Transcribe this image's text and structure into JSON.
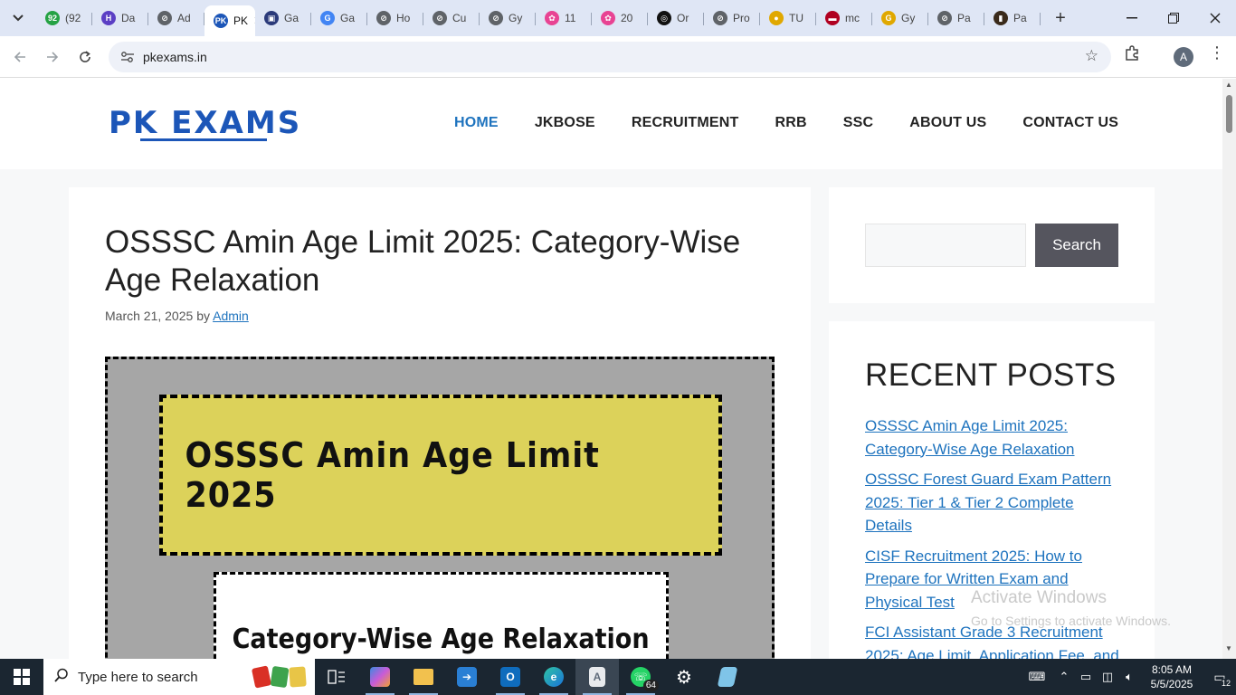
{
  "browser": {
    "tabs": [
      {
        "label": "(92",
        "color": "#25a244",
        "glyph": "92"
      },
      {
        "label": "Da",
        "color": "#5b3fc4",
        "glyph": "H"
      },
      {
        "label": "Ad",
        "color": "#5f6368",
        "glyph": "⊘"
      },
      {
        "label": "PK",
        "color": "#1c56b8",
        "glyph": "PK",
        "active": true
      },
      {
        "label": "Ga",
        "color": "#2b3a7a",
        "glyph": "▣"
      },
      {
        "label": "Ga",
        "color": "#4285f4",
        "glyph": "G"
      },
      {
        "label": "Ho",
        "color": "#5f6368",
        "glyph": "⊘"
      },
      {
        "label": "Cu",
        "color": "#5f6368",
        "glyph": "⊘"
      },
      {
        "label": "Gy",
        "color": "#5f6368",
        "glyph": "⊘"
      },
      {
        "label": "11",
        "color": "#e84393",
        "glyph": "✿"
      },
      {
        "label": "20",
        "color": "#e84393",
        "glyph": "✿"
      },
      {
        "label": "Or",
        "color": "#111111",
        "glyph": "◎"
      },
      {
        "label": "Pro",
        "color": "#5f6368",
        "glyph": "⊘"
      },
      {
        "label": "TU",
        "color": "#e0a800",
        "glyph": "●"
      },
      {
        "label": "mc",
        "color": "#b00020",
        "glyph": "▬"
      },
      {
        "label": "Gy",
        "color": "#e0a800",
        "glyph": "G"
      },
      {
        "label": "Pa",
        "color": "#5f6368",
        "glyph": "⊘"
      },
      {
        "label": "Pa",
        "color": "#3a2a1a",
        "glyph": "▮"
      }
    ],
    "active_tab_close": "✕",
    "new_tab": "+",
    "url": "pkexams.in",
    "avatar_letter": "A",
    "icons": {
      "tab_search": "chevron-down-icon",
      "back": "arrow-left-icon",
      "forward": "arrow-right-icon",
      "reload": "reload-icon",
      "site_info": "tune-icon",
      "bookmark": "star-icon",
      "extensions": "puzzle-icon",
      "menu": "kebab-icon"
    }
  },
  "site": {
    "logo": "PK EXAMS",
    "nav": [
      {
        "label": "HOME",
        "current": true
      },
      {
        "label": "JKBOSE"
      },
      {
        "label": "RECRUITMENT"
      },
      {
        "label": "RRB"
      },
      {
        "label": "SSC"
      },
      {
        "label": "ABOUT US"
      },
      {
        "label": "CONTACT US"
      }
    ],
    "accent": "#1e73be",
    "logo_color": "#1c56b8"
  },
  "post": {
    "title": "OSSSC Amin Age Limit 2025: Category-Wise Age Relaxation",
    "date": "March 21, 2025",
    "by": "by",
    "author": "Admin",
    "image_headline": "OSSSC Amin Age Limit 2025",
    "image_subheadline": "Category-Wise Age Relaxation"
  },
  "sidebar": {
    "search_button": "Search",
    "search_placeholder": "",
    "recent_title": "RECENT POSTS",
    "recent_posts": [
      "OSSSC Amin Age Limit 2025: Category-Wise Age Relaxation",
      "OSSSC Forest Guard Exam Pattern 2025: Tier 1 & Tier 2 Complete Details",
      "CISF Recruitment 2025: How to Prepare for Written Exam and Physical Test",
      "FCI Assistant Grade 3 Recruitment 2025: Age Limit, Application Fee, and"
    ]
  },
  "watermark": {
    "line1": "Activate Windows",
    "line2": "Go to Settings to activate Windows."
  },
  "taskbar": {
    "search_placeholder": "Type here to search",
    "whatsapp_badge": "64",
    "time": "8:05 AM",
    "date": "5/5/2025",
    "notification_count": "12"
  }
}
